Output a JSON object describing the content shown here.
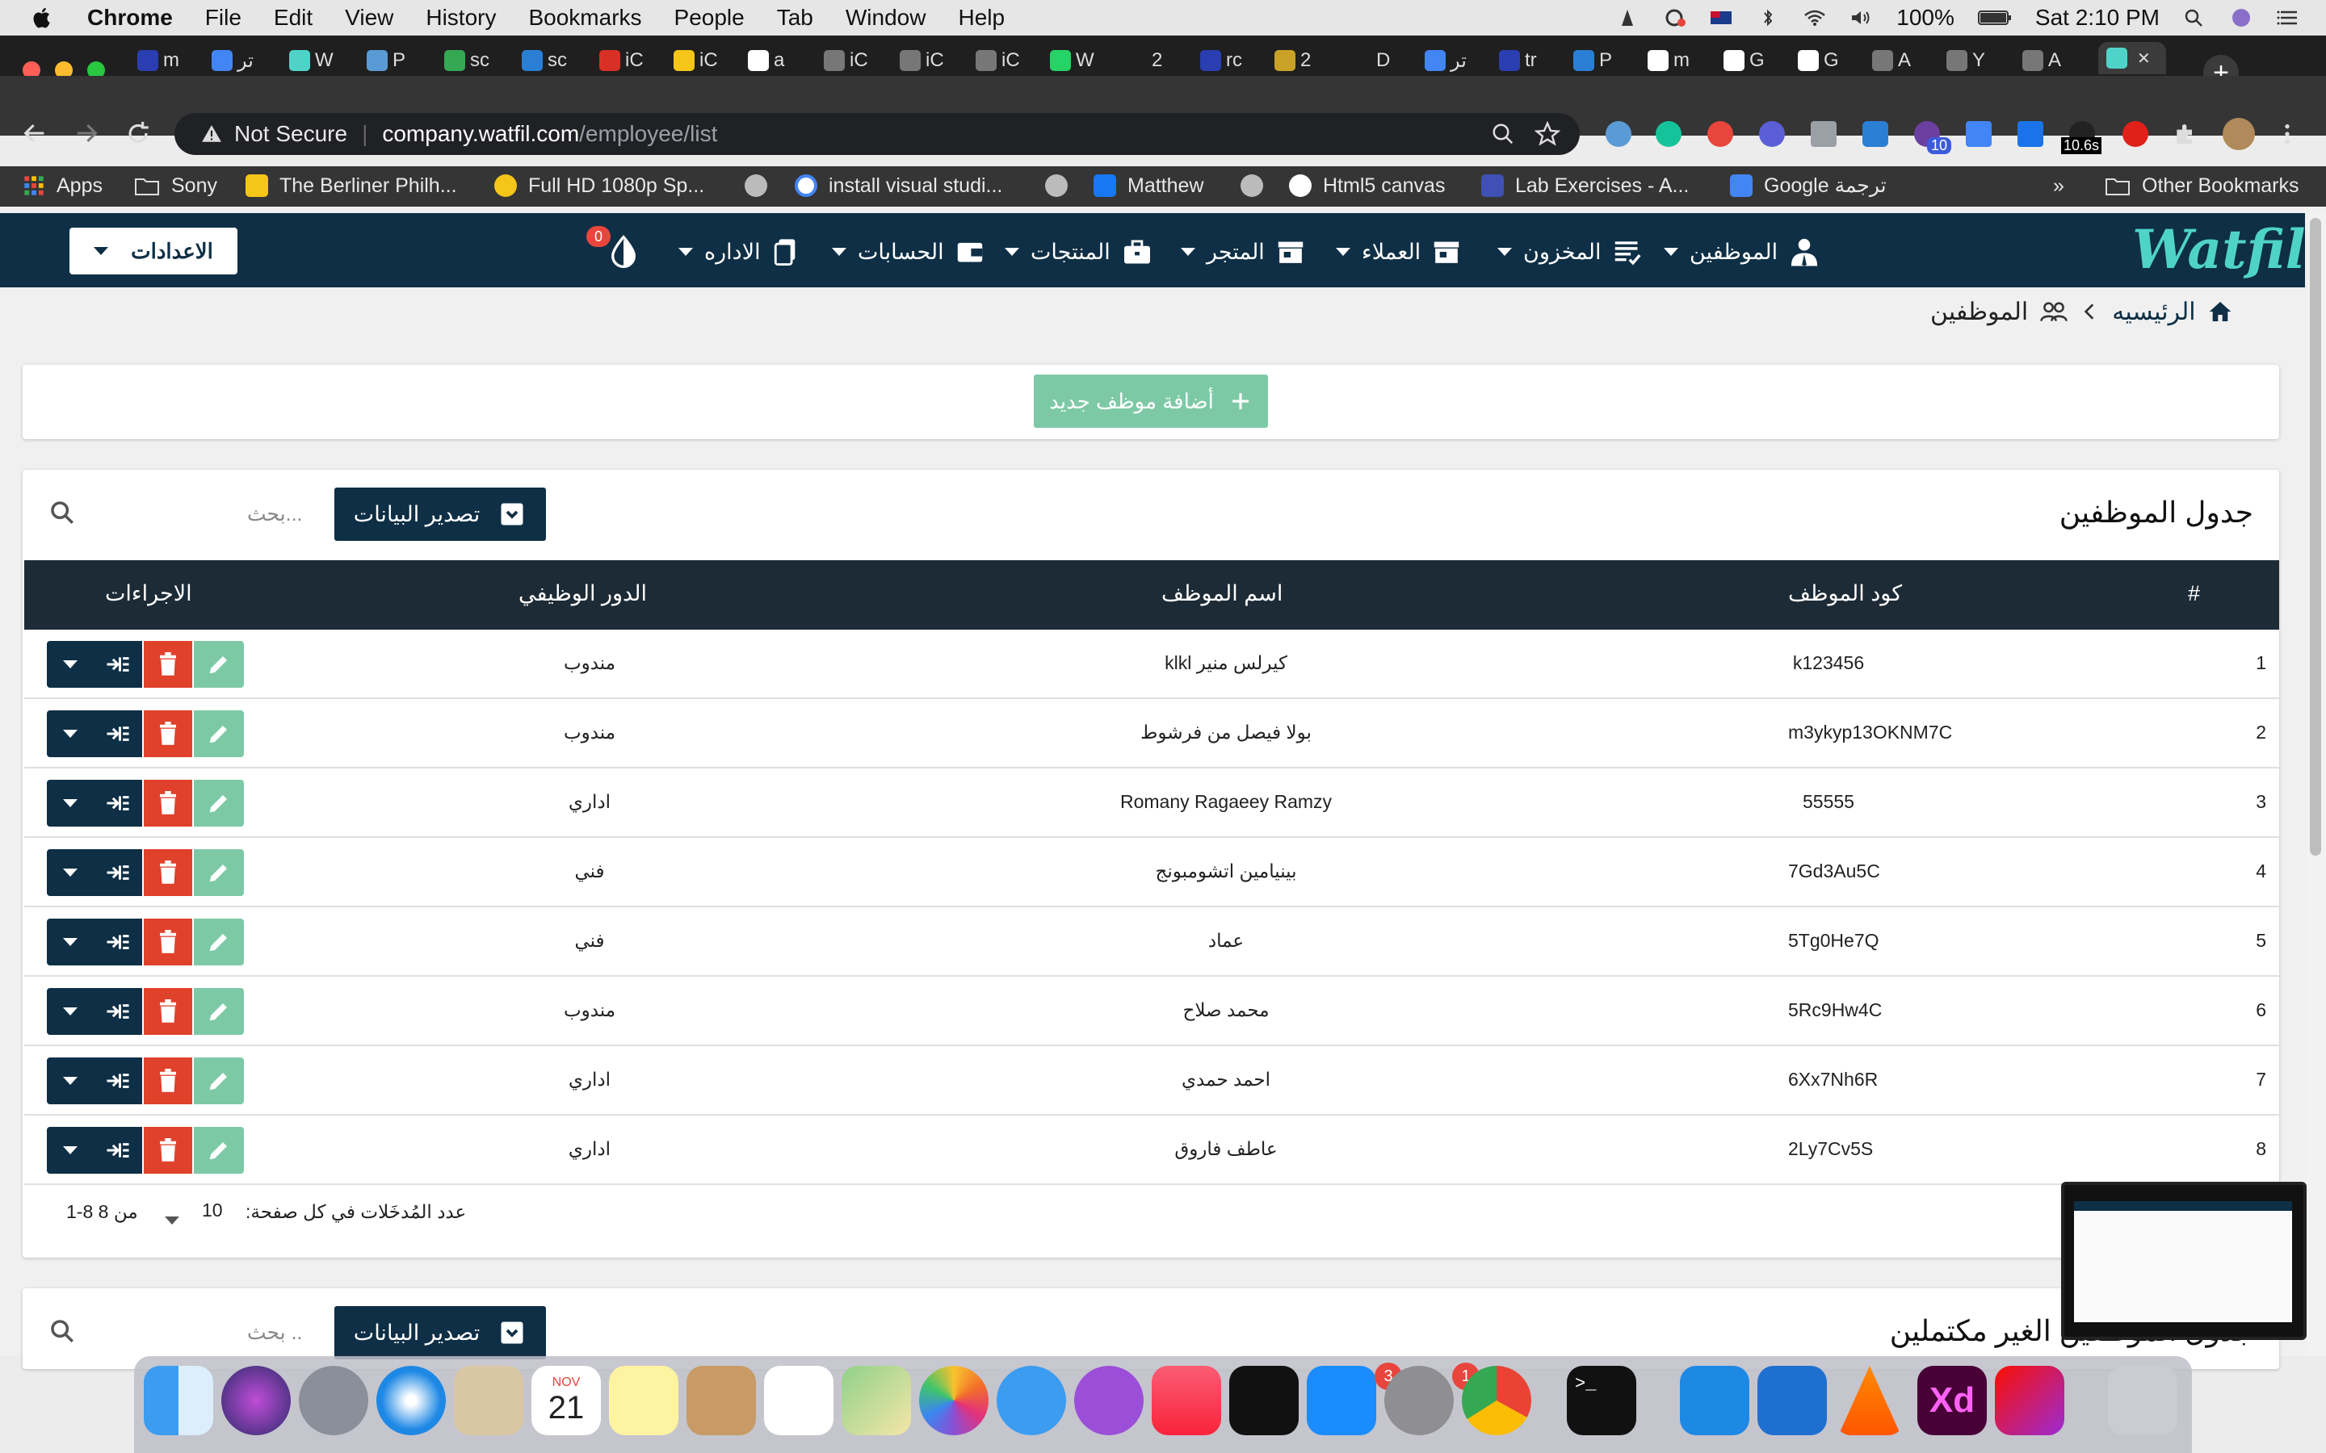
{
  "menubar": {
    "app_name": "Chrome",
    "menus": [
      "File",
      "Edit",
      "View",
      "History",
      "Bookmarks",
      "People",
      "Tab",
      "Window",
      "Help"
    ],
    "battery": "100%",
    "clock": "Sat 2:10 PM"
  },
  "tabs": [
    {
      "label": "m",
      "color": "#2a3eb1"
    },
    {
      "label": "تر",
      "color": "#4285f4"
    },
    {
      "label": "W",
      "color": "#4fd3c9"
    },
    {
      "label": "P",
      "color": "#5b9bd5"
    },
    {
      "label": "sc",
      "color": "#34a853"
    },
    {
      "label": "sc",
      "color": "#2a7fd4"
    },
    {
      "label": "iC",
      "color": "#d93025"
    },
    {
      "label": "iC",
      "color": "#f5c518"
    },
    {
      "label": "a",
      "color": "#ffffff"
    },
    {
      "label": "iC",
      "color": "#777777"
    },
    {
      "label": "iC",
      "color": "#777777"
    },
    {
      "label": "iC",
      "color": "#777777"
    },
    {
      "label": "W",
      "color": "#25d366"
    },
    {
      "label": "2",
      "color": "#1f1f1f"
    },
    {
      "label": "rc",
      "color": "#2a3eb1"
    },
    {
      "label": "2",
      "color": "#c9a227"
    },
    {
      "label": "D",
      "color": "#1f1f1f"
    },
    {
      "label": "تر",
      "color": "#4285f4"
    },
    {
      "label": "tr",
      "color": "#2a3eb1"
    },
    {
      "label": "P",
      "color": "#2a7fd4"
    },
    {
      "label": "m",
      "color": "#ffffff"
    },
    {
      "label": "G",
      "color": "#ffffff"
    },
    {
      "label": "G",
      "color": "#ffffff"
    },
    {
      "label": "A",
      "color": "#777777"
    },
    {
      "label": "Y",
      "color": "#777777"
    },
    {
      "label": "A",
      "color": "#777777"
    },
    {
      "label": "",
      "color": "#4fd3c9",
      "active": true
    }
  ],
  "omnibox": {
    "security": "Not Secure",
    "host": "company.watfil.com",
    "path": "/employee/list",
    "timer_badge": "10.6s",
    "ext_badge": "10"
  },
  "bookmarks": {
    "items": [
      {
        "label": "Apps",
        "color": "#e8453c"
      },
      {
        "label": "Sony",
        "color": "#bbbbbb"
      },
      {
        "label": "The Berliner Philh...",
        "color": "#f5c518"
      },
      {
        "label": "Full HD 1080p Sp...",
        "color": "#f5c518"
      },
      {
        "label": "",
        "color": "#bbbbbb"
      },
      {
        "label": "install visual studi...",
        "color": "#4285f4"
      },
      {
        "label": "",
        "color": "#bbbbbb"
      },
      {
        "label": "Matthew",
        "color": "#1877f2"
      },
      {
        "label": "",
        "color": "#bbbbbb"
      },
      {
        "label": "Html5 canvas",
        "color": "#ffffff"
      },
      {
        "label": "Lab Exercises - A...",
        "color": "#3f51b5"
      },
      {
        "label": "Google ترجمة",
        "color": "#4285f4"
      }
    ],
    "overflow": "»",
    "other": "Other Bookmarks"
  },
  "navbar": {
    "logo_text": "Watfil",
    "settings_label": "الاعدادات",
    "items": [
      {
        "label": "الموظفين",
        "icon": "employee-icon"
      },
      {
        "label": "المخزون",
        "icon": "inventory-icon"
      },
      {
        "label": "العملاء",
        "icon": "store-icon"
      },
      {
        "label": "المتجر",
        "icon": "shop-icon"
      },
      {
        "label": "المنتجات",
        "icon": "briefcase-icon"
      },
      {
        "label": "الحسابات",
        "icon": "wallet-icon"
      },
      {
        "label": "الاداره",
        "icon": "document-icon"
      }
    ],
    "notification_count": "0"
  },
  "breadcrumb": {
    "home": "الرئيسيه",
    "current": "الموظفين"
  },
  "add_button": "أضافة موظف جديد",
  "employees_table": {
    "title": "جدول الموظفين",
    "export_label": "تصدير البيانات",
    "search_placeholder": "بحث...",
    "columns": [
      "#",
      "كود الموظف",
      "اسم الموظف",
      "الدور الوظيفي",
      "الاجراءات"
    ],
    "rows": [
      {
        "num": "1",
        "code": "k123456",
        "name": "كيرلس منير klkl",
        "role": "مندوب"
      },
      {
        "num": "2",
        "code": "m3ykyp13OKNM7C",
        "name": "بولا فيصل من فرشوط",
        "role": "مندوب"
      },
      {
        "num": "3",
        "code": "55555",
        "name": "Romany Ragaeey Ramzy",
        "role": "اداري"
      },
      {
        "num": "4",
        "code": "7Gd3Au5C",
        "name": "بينيامين اتشومبونج",
        "role": "فني"
      },
      {
        "num": "5",
        "code": "5Tg0He7Q",
        "name": "عماد",
        "role": "فني"
      },
      {
        "num": "6",
        "code": "5Rc9Hw4C",
        "name": "محمد صلاح",
        "role": "مندوب"
      },
      {
        "num": "7",
        "code": "6Xx7Nh6R",
        "name": "احمد حمدي",
        "role": "اداري"
      },
      {
        "num": "8",
        "code": "2Ly7Cv5S",
        "name": "عاطف فاروق",
        "role": "اداري"
      }
    ],
    "pagination": {
      "rows_per_page_label": "عدد المُدخَلات في كل صفحة:",
      "rows_per_page": "10",
      "range": "1-8 من 8"
    }
  },
  "incomplete_table": {
    "title": "جدول الموظفين الغير مكتملين",
    "export_label": "تصدير البيانات",
    "search_placeholder": "بحث .."
  },
  "dock": {
    "calendar_month": "NOV",
    "calendar_day": "21",
    "appstore_badge": "3",
    "settings_badge": "1",
    "xd_label": "Xd",
    "terminal_label": ">_"
  }
}
